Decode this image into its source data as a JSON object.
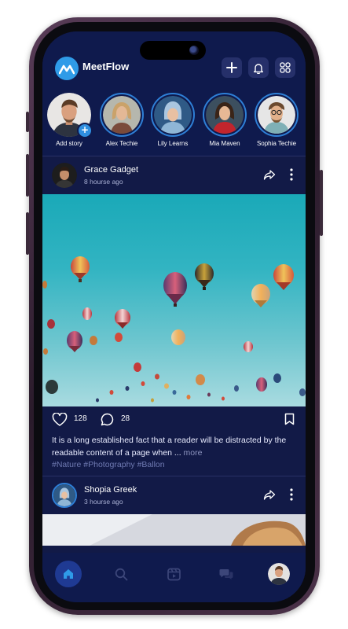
{
  "app": {
    "name": "MeetFlow",
    "colors": {
      "bg": "#121a47",
      "header": "#0f1a4d",
      "accent": "#2f9be8",
      "tag": "#6f7ab2"
    }
  },
  "header": {
    "logo_icon": "meetflow-logo-icon",
    "actions": [
      {
        "name": "create-button",
        "icon": "plus-icon"
      },
      {
        "name": "notifications-button",
        "icon": "bell-icon"
      },
      {
        "name": "apps-button",
        "icon": "grid-icon"
      }
    ]
  },
  "stories": [
    {
      "label": "Add story",
      "is_add": true
    },
    {
      "label": "Alex Techie"
    },
    {
      "label": "Lily Learns"
    },
    {
      "label": "Mia Maven"
    },
    {
      "label": "Sophia Techie"
    }
  ],
  "posts": [
    {
      "author": "Grace Gadget",
      "time": "8 hourse ago",
      "likes": "128",
      "comments": "28",
      "caption": "It is a long established fact that a reader will be distracted by the readable content of a page when ...",
      "more_label": "more",
      "tags": "#Nature #Photography #Ballon"
    },
    {
      "author": "Shopia Greek",
      "time": "3 hourse ago"
    }
  ],
  "bottom_nav": [
    {
      "name": "home",
      "icon": "home-icon",
      "active": true
    },
    {
      "name": "search",
      "icon": "search-icon"
    },
    {
      "name": "reels",
      "icon": "video-icon"
    },
    {
      "name": "messages",
      "icon": "chat-icon"
    },
    {
      "name": "profile",
      "icon": "avatar"
    }
  ]
}
